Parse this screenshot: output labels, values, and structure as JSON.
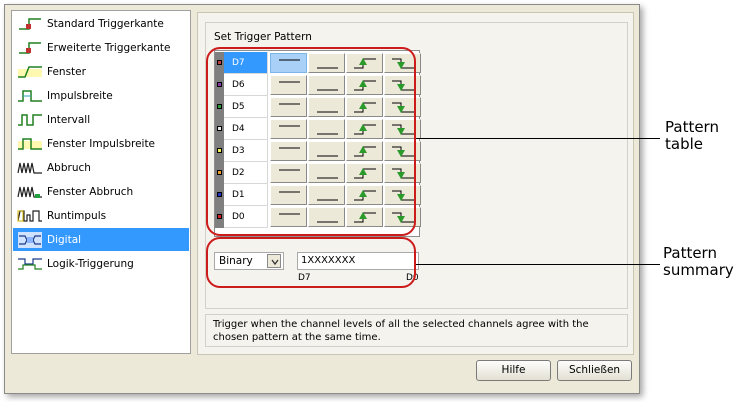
{
  "trigger_list": [
    {
      "label": "Standard Triggerkante",
      "icon": "standard-edge-trigger-icon"
    },
    {
      "label": "Erweiterte Triggerkante",
      "icon": "advanced-edge-trigger-icon"
    },
    {
      "label": "Fenster",
      "icon": "window-trigger-icon"
    },
    {
      "label": "Impulsbreite",
      "icon": "pulse-width-trigger-icon"
    },
    {
      "label": "Intervall",
      "icon": "interval-trigger-icon"
    },
    {
      "label": "Fenster Impulsbreite",
      "icon": "window-pulse-width-trigger-icon"
    },
    {
      "label": "Abbruch",
      "icon": "dropout-trigger-icon"
    },
    {
      "label": "Fenster Abbruch",
      "icon": "window-dropout-trigger-icon"
    },
    {
      "label": "Runtimpuls",
      "icon": "runt-pulse-trigger-icon"
    },
    {
      "label": "Digital",
      "icon": "digital-trigger-icon"
    },
    {
      "label": "Logik-Triggerung",
      "icon": "logic-trigger-icon"
    }
  ],
  "selected_trigger": "Digital",
  "pattern_group": {
    "title": "Set Trigger Pattern"
  },
  "channels": [
    {
      "name": "D7",
      "color": "#c04040"
    },
    {
      "name": "D6",
      "color": "#8a3aa8"
    },
    {
      "name": "D5",
      "color": "#2e9a2e"
    },
    {
      "name": "D4",
      "color": "#e8e8e8"
    },
    {
      "name": "D3",
      "color": "#f0f050"
    },
    {
      "name": "D2",
      "color": "#f0a020"
    },
    {
      "name": "D1",
      "color": "#2030c0"
    },
    {
      "name": "D0",
      "color": "#d02020"
    }
  ],
  "pattern_states": [
    "high",
    "low",
    "rising-edge",
    "falling-edge"
  ],
  "format_select": {
    "value": "Binary"
  },
  "pattern_input": {
    "value": "1XXXXXXX"
  },
  "bit_labels": {
    "msb": "D7",
    "lsb": "D0"
  },
  "description": "Trigger when the channel levels of all the selected channels agree with the chosen pattern at the same time.",
  "buttons": {
    "help": "Hilfe",
    "close": "Schließen"
  },
  "callouts": {
    "pattern_table": "Pattern\ntable",
    "pattern_summary": "Pattern\nsummary"
  },
  "colors": {
    "selection": "#3399ff",
    "callout": "#cc1b1b",
    "active_cell": "#a9d1f7"
  }
}
